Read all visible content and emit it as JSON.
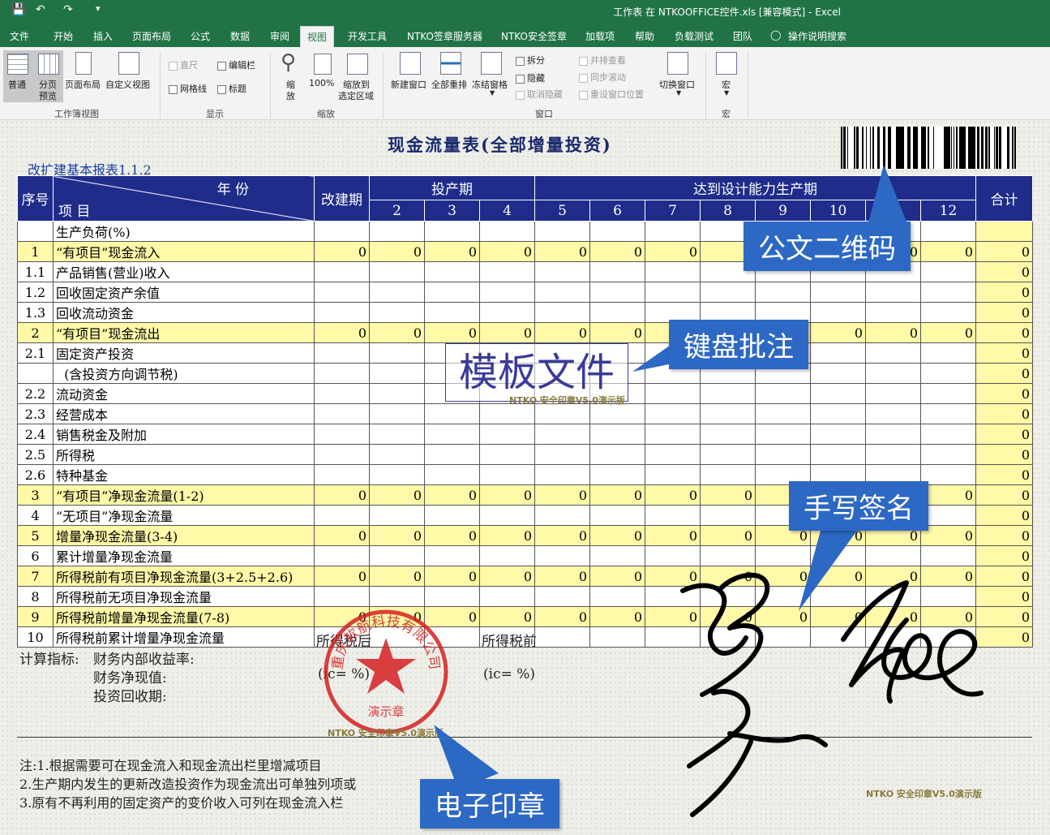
{
  "window": {
    "title": "工作表 在 NTKOOFFICE控件.xls  [兼容模式]  -  Excel",
    "quick_access": [
      "save-icon",
      "undo-icon",
      "redo-icon",
      "customize-icon"
    ]
  },
  "menu": {
    "tabs": [
      "文件",
      "开始",
      "插入",
      "页面布局",
      "公式",
      "数据",
      "审阅",
      "视图",
      "开发工具",
      "NTKO签章服务器",
      "NTKO安全签章",
      "加载项",
      "帮助",
      "负载测试",
      "团队"
    ],
    "active": "视图",
    "tell_me": "操作说明搜索"
  },
  "ribbon": {
    "groups": {
      "workbook_views": {
        "label": "工作簿视图",
        "normal": "普通",
        "page_break_1": "分页",
        "page_break_2": "预览",
        "page_layout": "页面布局",
        "custom": "自定义视图"
      },
      "show": {
        "label": "显示",
        "ruler": "直尺",
        "formula_bar": "编辑栏",
        "gridlines": "网格线",
        "headings": "标题"
      },
      "zoom": {
        "label": "缩放",
        "zoom_1": "缩",
        "zoom_2": "放",
        "hundred": "100%",
        "to_sel_1": "缩放到",
        "to_sel_2": "选定区域"
      },
      "window": {
        "label": "窗口",
        "new_window": "新建窗口",
        "arrange_all": "全部重排",
        "freeze": "冻结窗格",
        "split": "拆分",
        "hide": "隐藏",
        "unhide": "取消隐藏",
        "side_by_side": "并排查看",
        "sync_scroll": "同步滚动",
        "reset_pos": "重设窗口位置",
        "switch": "切换窗口"
      },
      "macro": {
        "label": "宏",
        "macros": "宏"
      }
    }
  },
  "sheet": {
    "title": "现金流量表(全部增量投资)",
    "form_code": "改扩建基本报表1.1.2",
    "header": {
      "seq": "序号",
      "year": "年  份",
      "item": "项  目",
      "reconstruct": "改建期",
      "production": "投产期",
      "design": "达到设计能力生产期",
      "total": "合计",
      "years": [
        "2",
        "3",
        "4",
        "5",
        "6",
        "7",
        "8",
        "9",
        "10",
        "11",
        "12"
      ]
    },
    "rows": [
      {
        "seq": "",
        "item": "生产负荷(%)",
        "hl": false,
        "vals": [
          "",
          "",
          "",
          "",
          "",
          "",
          "",
          "",
          "",
          "",
          "",
          ""
        ],
        "total": ""
      },
      {
        "seq": "1",
        "item": "“有项目”现金流入",
        "hl": true,
        "vals": [
          "0",
          "0",
          "0",
          "0",
          "0",
          "0",
          "0",
          "0",
          "0",
          "0",
          "0",
          "0"
        ],
        "total": "0"
      },
      {
        "seq": "1.1",
        "item": "产品销售(营业)收入",
        "hl": false,
        "vals": [
          "",
          "",
          "",
          "",
          "",
          "",
          "",
          "",
          "",
          "",
          "",
          ""
        ],
        "total": "0"
      },
      {
        "seq": "1.2",
        "item": "回收固定资产余值",
        "hl": false,
        "vals": [
          "",
          "",
          "",
          "",
          "",
          "",
          "",
          "",
          "",
          "",
          "",
          ""
        ],
        "total": "0"
      },
      {
        "seq": "1.3",
        "item": "回收流动资金",
        "hl": false,
        "vals": [
          "",
          "",
          "",
          "",
          "",
          "",
          "",
          "",
          "",
          "",
          "",
          ""
        ],
        "total": "0"
      },
      {
        "seq": "2",
        "item": "“有项目”现金流出",
        "hl": true,
        "vals": [
          "0",
          "0",
          "0",
          "0",
          "0",
          "0",
          "0",
          "0",
          "0",
          "0",
          "0",
          "0"
        ],
        "total": "0"
      },
      {
        "seq": "2.1",
        "item": "固定资产投资",
        "hl": false,
        "vals": [
          "",
          "",
          "",
          "",
          "",
          "",
          "",
          "",
          "",
          "",
          "",
          ""
        ],
        "total": "0"
      },
      {
        "seq": "",
        "item": "  (含投资方向调节税)",
        "hl": false,
        "vals": [
          "",
          "",
          "",
          "",
          "",
          "",
          "",
          "",
          "",
          "",
          "",
          ""
        ],
        "total": "0"
      },
      {
        "seq": "2.2",
        "item": "流动资金",
        "hl": false,
        "vals": [
          "",
          "",
          "",
          "",
          "",
          "",
          "",
          "",
          "",
          "",
          "",
          ""
        ],
        "total": "0"
      },
      {
        "seq": "2.3",
        "item": "经营成本",
        "hl": false,
        "vals": [
          "",
          "",
          "",
          "",
          "",
          "",
          "",
          "",
          "",
          "",
          "",
          ""
        ],
        "total": "0"
      },
      {
        "seq": "2.4",
        "item": "销售税金及附加",
        "hl": false,
        "vals": [
          "",
          "",
          "",
          "",
          "",
          "",
          "",
          "",
          "",
          "",
          "",
          ""
        ],
        "total": "0"
      },
      {
        "seq": "2.5",
        "item": "所得税",
        "hl": false,
        "vals": [
          "",
          "",
          "",
          "",
          "",
          "",
          "",
          "",
          "",
          "",
          "",
          ""
        ],
        "total": "0"
      },
      {
        "seq": "2.6",
        "item": "特种基金",
        "hl": false,
        "vals": [
          "",
          "",
          "",
          "",
          "",
          "",
          "",
          "",
          "",
          "",
          "",
          ""
        ],
        "total": "0"
      },
      {
        "seq": "3",
        "item": "“有项目”净现金流量(1-2)",
        "hl": true,
        "vals": [
          "0",
          "0",
          "0",
          "0",
          "0",
          "0",
          "0",
          "0",
          "0",
          "0",
          "0",
          "0"
        ],
        "total": "0"
      },
      {
        "seq": "4",
        "item": "“无项目”净现金流量",
        "hl": false,
        "vals": [
          "",
          "",
          "",
          "",
          "",
          "",
          "",
          "",
          "",
          "",
          "",
          ""
        ],
        "total": "0"
      },
      {
        "seq": "5",
        "item": "增量净现金流量(3-4)",
        "hl": true,
        "vals": [
          "0",
          "0",
          "0",
          "0",
          "0",
          "0",
          "0",
          "0",
          "0",
          "0",
          "0",
          "0"
        ],
        "total": "0"
      },
      {
        "seq": "6",
        "item": "累计增量净现金流量",
        "hl": false,
        "vals": [
          "",
          "",
          "",
          "",
          "",
          "",
          "",
          "",
          "",
          "",
          "",
          ""
        ],
        "total": "0"
      },
      {
        "seq": "7",
        "item": "所得税前有项目净现金流量(3+2.5+2.6)",
        "hl": true,
        "vals": [
          "0",
          "0",
          "0",
          "0",
          "0",
          "0",
          "0",
          "0",
          "0",
          "0",
          "0",
          "0"
        ],
        "total": "0"
      },
      {
        "seq": "8",
        "item": "所得税前无项目净现金流量",
        "hl": false,
        "vals": [
          "",
          "",
          "",
          "",
          "",
          "",
          "",
          "",
          "",
          "",
          "",
          ""
        ],
        "total": "0"
      },
      {
        "seq": "9",
        "item": "所得税前增量净现金流量(7-8)",
        "hl": true,
        "vals": [
          "0",
          "0",
          "0",
          "0",
          "0",
          "0",
          "0",
          "0",
          "0",
          "0",
          "0",
          "0"
        ],
        "total": "0"
      },
      {
        "seq": "10",
        "item": "所得税前累计增量净现金流量",
        "hl": false,
        "vals": [
          "",
          "",
          "",
          "",
          "",
          "",
          "",
          "",
          "",
          "",
          "",
          ""
        ],
        "total": "0"
      }
    ],
    "calc": {
      "label": "计算指标:",
      "irr": "财务内部收益率:",
      "npv": "财务净现值:",
      "payback": "投资回收期:",
      "after_tax": "所得税后",
      "before_tax": "所得税前",
      "ic_after": "(ic=    %)",
      "ic_before": "(ic=    %)"
    },
    "notes": [
      "注:1.根据需要可在现金流入和现金流出栏里增减项目",
      "    2.生产期内发生的更新改造投资作为现金流出可单独列项或",
      "    3.原有不再利用的固定资产的变价收入可列在现金流入栏"
    ]
  },
  "annotations": {
    "qr_label": "公文二维码",
    "keyboard_label": "键盘批注",
    "handwriting_label": "手写签名",
    "seal_label": "电子印章",
    "template_text": "模板文件",
    "watermark": "NTKO 安全印章V5.0演示版",
    "seal_company": "重庆软航科技有限公司",
    "seal_bottom": "演示章"
  }
}
